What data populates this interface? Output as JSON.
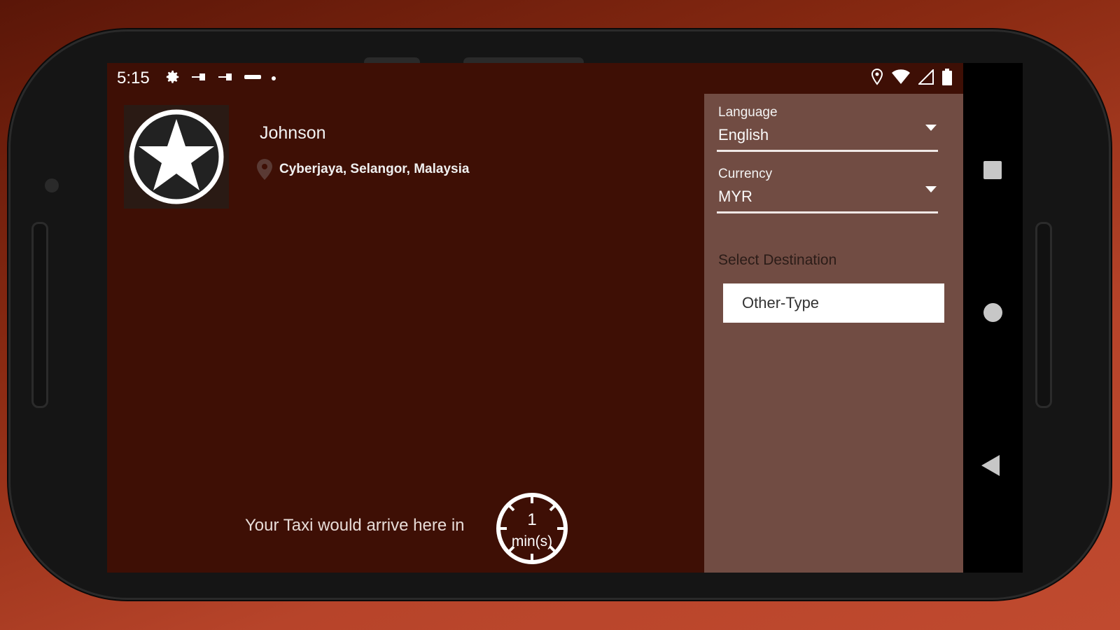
{
  "statusbar": {
    "time": "5:15",
    "left_icons": [
      "gear-icon",
      "usb-icon",
      "usb-icon",
      "carrier-icon",
      "dot-icon"
    ],
    "right_icons": [
      "location-icon",
      "wifi-icon",
      "signal-icon",
      "battery-icon"
    ]
  },
  "profile": {
    "name": "Johnson",
    "location": "Cyberjaya, Selangor, Malaysia",
    "avatar_icon": "star-icon"
  },
  "arrival": {
    "text": "Your Taxi would arrive here in",
    "minutes": "1",
    "unit": "min(s)"
  },
  "panel": {
    "language": {
      "label": "Language",
      "value": "English"
    },
    "currency": {
      "label": "Currency",
      "value": "MYR"
    },
    "destination_label": "Select Destination",
    "destination_value": "Other-Type"
  },
  "navbar": {
    "icons": [
      "recents-icon",
      "home-icon",
      "back-icon"
    ]
  },
  "colors": {
    "screen_bg": "#3e0f05",
    "panel_bg": "#714c43",
    "accent": "#ffffff"
  }
}
